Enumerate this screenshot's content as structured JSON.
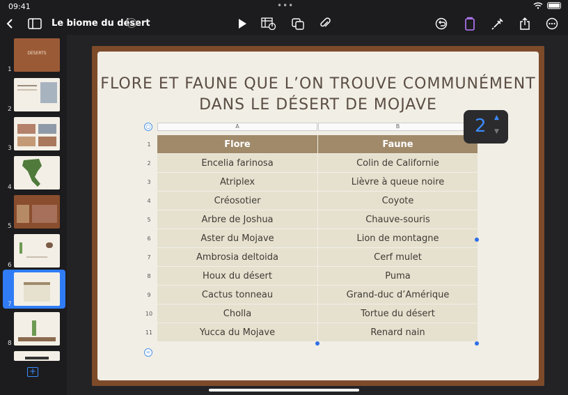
{
  "status": {
    "time": "09:41",
    "dots": "•••"
  },
  "toolbar": {
    "doc_title": "Le biome du désert",
    "icons": [
      "back-icon",
      "sidebar-toggle-icon",
      "title-chevron-icon",
      "play-icon",
      "table-chart-icon",
      "shapes-icon",
      "attachment-icon",
      "undo-icon",
      "format-icon",
      "brush-icon",
      "share-icon",
      "more-icon"
    ]
  },
  "slides": [
    {
      "num": "1",
      "title": "DÉSERTS"
    },
    {
      "num": "2"
    },
    {
      "num": "3"
    },
    {
      "num": "4"
    },
    {
      "num": "5"
    },
    {
      "num": "6"
    },
    {
      "num": "7"
    },
    {
      "num": "8"
    }
  ],
  "slide": {
    "title_line1": "FLORE ET FAUNE QUE L’ON TROUVE COMMUNÉMENT",
    "title_line2": "DANS LE DÉSERT DE MOJAVE"
  },
  "table": {
    "col_letters": [
      "A",
      "B"
    ],
    "headers": [
      "Flore",
      "Faune"
    ],
    "rows": [
      [
        "Encelia farinosa",
        "Colin de Californie"
      ],
      [
        "Atriplex",
        "Lièvre à queue noire"
      ],
      [
        "Créosotier",
        "Coyote"
      ],
      [
        "Arbre de Joshua",
        "Chauve-souris"
      ],
      [
        "Aster du Mojave",
        "Lion de montagne"
      ],
      [
        "Ambrosia deltoida",
        "Cerf mulet"
      ],
      [
        "Houx du désert",
        "Puma"
      ],
      [
        "Cactus tonneau",
        "Grand-duc d’Amérique"
      ],
      [
        "Cholla",
        "Tortue du désert"
      ],
      [
        "Yucca du Mojave",
        "Renard nain"
      ]
    ],
    "row_numbers": [
      "1",
      "2",
      "3",
      "4",
      "5",
      "6",
      "7",
      "8",
      "9",
      "10",
      "11"
    ]
  },
  "stepper": {
    "value": "2"
  },
  "colors": {
    "accent": "#3b8cff",
    "header_fill": "#a08a6a",
    "body_fill": "#e6e1cf",
    "slide_frame": "#7d4a2a"
  }
}
